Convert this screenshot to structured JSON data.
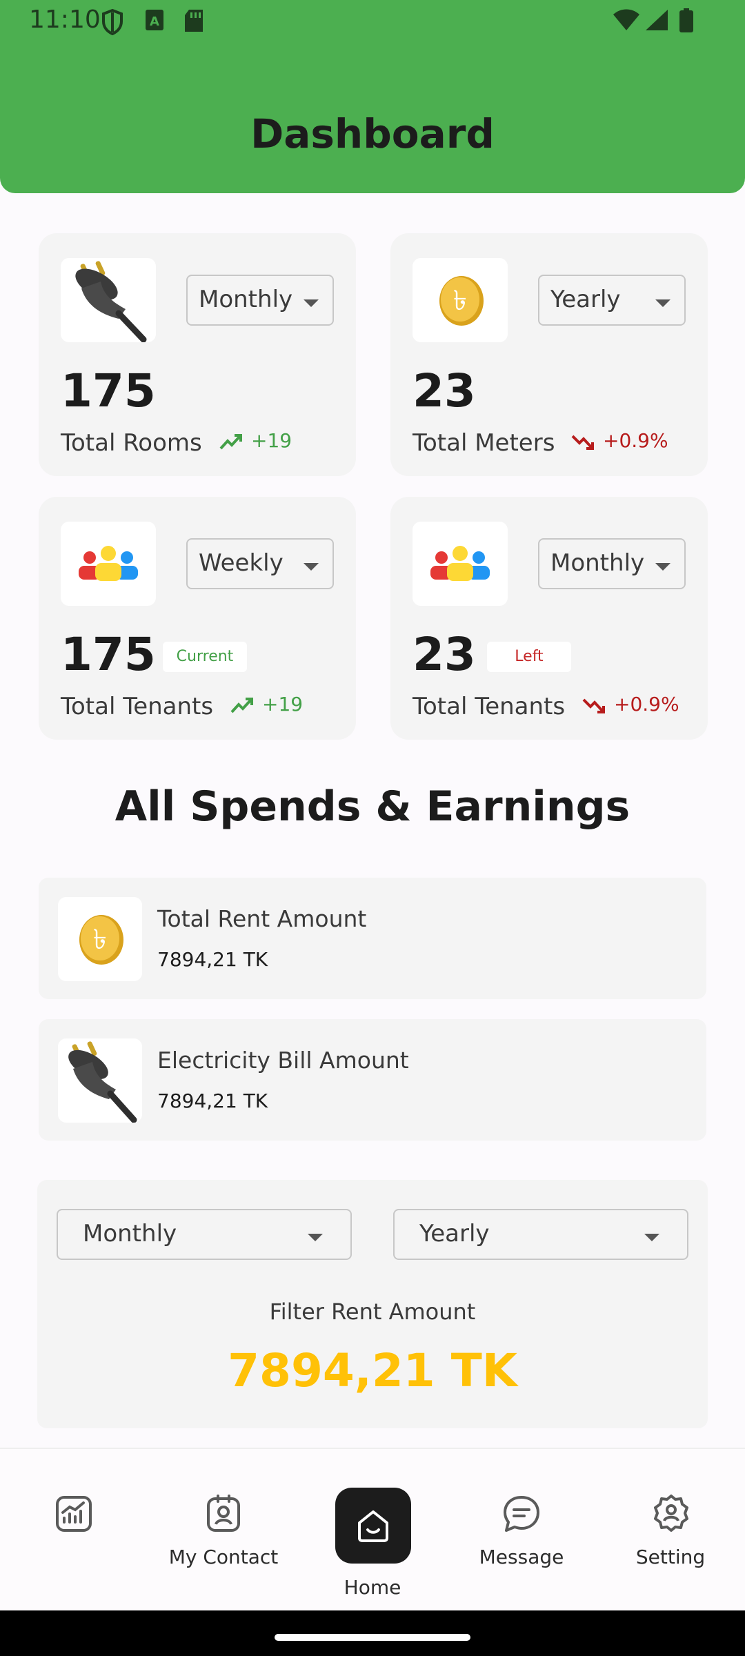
{
  "status_bar": {
    "time": "11:10"
  },
  "header": {
    "title": "Dashboard"
  },
  "stats_cards": [
    {
      "icon": "plug-icon",
      "period": "Monthly",
      "value": "175",
      "label": "Total Rooms",
      "trend": "+19",
      "trend_direction": "up"
    },
    {
      "icon": "taka-coin-icon",
      "period": "Yearly",
      "value": "23",
      "label": "Total Meters",
      "trend": "+0.9%",
      "trend_direction": "down"
    },
    {
      "icon": "people-icon",
      "period": "Weekly",
      "value": "175",
      "tag": "Current",
      "label": "Total Tenants",
      "trend": "+19",
      "trend_direction": "up"
    },
    {
      "icon": "people-icon",
      "period": "Monthly",
      "value": "23",
      "tag": "Left",
      "label": "Total Tenants",
      "trend": "+0.9%",
      "trend_direction": "down"
    }
  ],
  "section": {
    "title": "All Spends & Earnings"
  },
  "summary_rows": [
    {
      "icon": "taka-coin-icon",
      "title": "Total Rent Amount",
      "amount": "7894,21 TK"
    },
    {
      "icon": "plug-icon",
      "title": "Electricity Bill Amount",
      "amount": "7894,21 TK"
    }
  ],
  "filter": {
    "period_select": "Monthly",
    "year_select": "Yearly",
    "label": "Filter Rent Amount",
    "amount": "7894,21 TK"
  },
  "bottom_nav": [
    {
      "icon": "chart-icon",
      "label": ""
    },
    {
      "icon": "contact-icon",
      "label": "My Contact"
    },
    {
      "icon": "home-icon",
      "label": "Home"
    },
    {
      "icon": "message-icon",
      "label": "Message"
    },
    {
      "icon": "gear-icon",
      "label": "Setting"
    }
  ],
  "colors": {
    "header_green": "#4caf50",
    "trend_up": "#43a047",
    "trend_down": "#b71c1c",
    "amount_accent": "#ffc107"
  }
}
